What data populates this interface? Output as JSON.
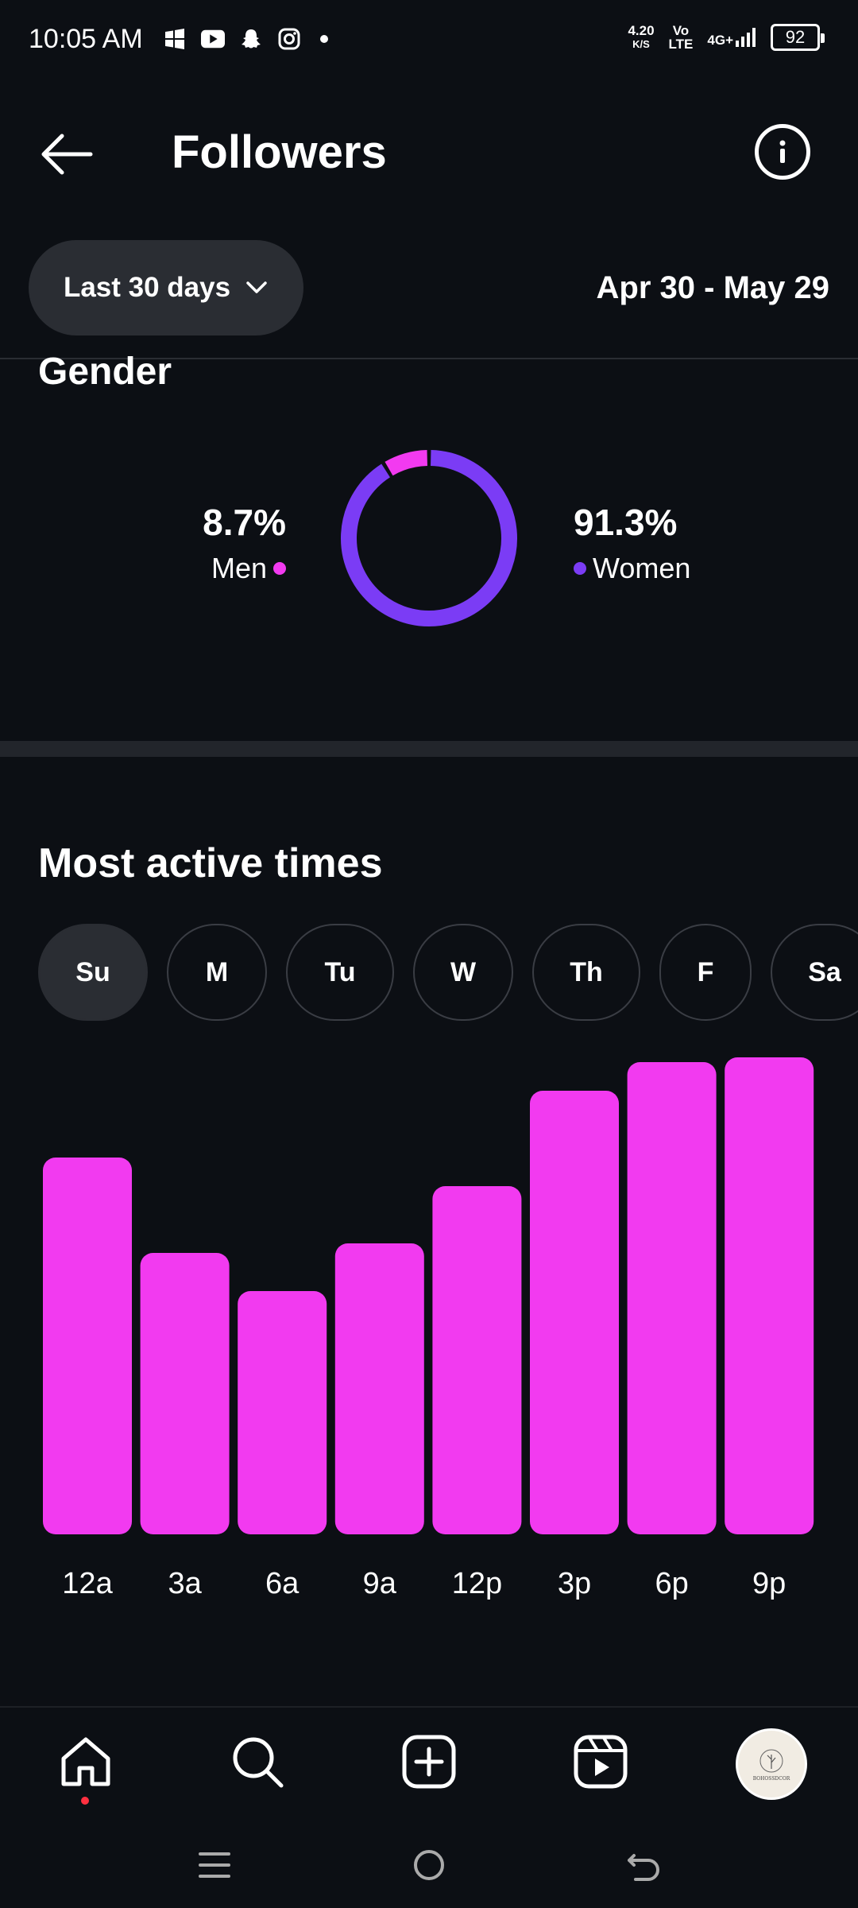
{
  "status": {
    "time": "10:05 AM",
    "speed_top": "4.20",
    "speed_unit": "K/S",
    "volte_top": "Vo",
    "volte_bottom": "LTE",
    "network": "4G+",
    "battery": "92"
  },
  "header": {
    "title": "Followers"
  },
  "filter": {
    "range_label": "Last 30 days",
    "date_range": "Apr 30 - May 29"
  },
  "gender": {
    "title": "Gender",
    "men_pct": "8.7%",
    "men_label": "Men",
    "women_pct": "91.3%",
    "women_label": "Women",
    "men_value": 8.7,
    "women_value": 91.3,
    "men_color": "#f23af0",
    "women_color": "#7b3cf5"
  },
  "active": {
    "title": "Most active times",
    "days": [
      "Su",
      "M",
      "Tu",
      "W",
      "Th",
      "F",
      "Sa"
    ],
    "selected_day": "Su"
  },
  "chart_data": {
    "type": "bar",
    "categories": [
      "12a",
      "3a",
      "6a",
      "9a",
      "12p",
      "3p",
      "6p",
      "9p"
    ],
    "values": [
      79,
      59,
      51,
      61,
      73,
      93,
      99,
      100
    ],
    "ylim": [
      0,
      100
    ],
    "grid": false,
    "bar_color": "#f23af0"
  },
  "nav": {
    "items": [
      "home-icon",
      "search-icon",
      "create-icon",
      "reels-icon",
      "profile-avatar"
    ],
    "avatar_text": "BOHOSSDCOR"
  },
  "colors": {
    "background": "#0c0f14",
    "pill": "#2a2d33",
    "accent_pink": "#f23af0",
    "accent_purple": "#7b3cf5"
  }
}
